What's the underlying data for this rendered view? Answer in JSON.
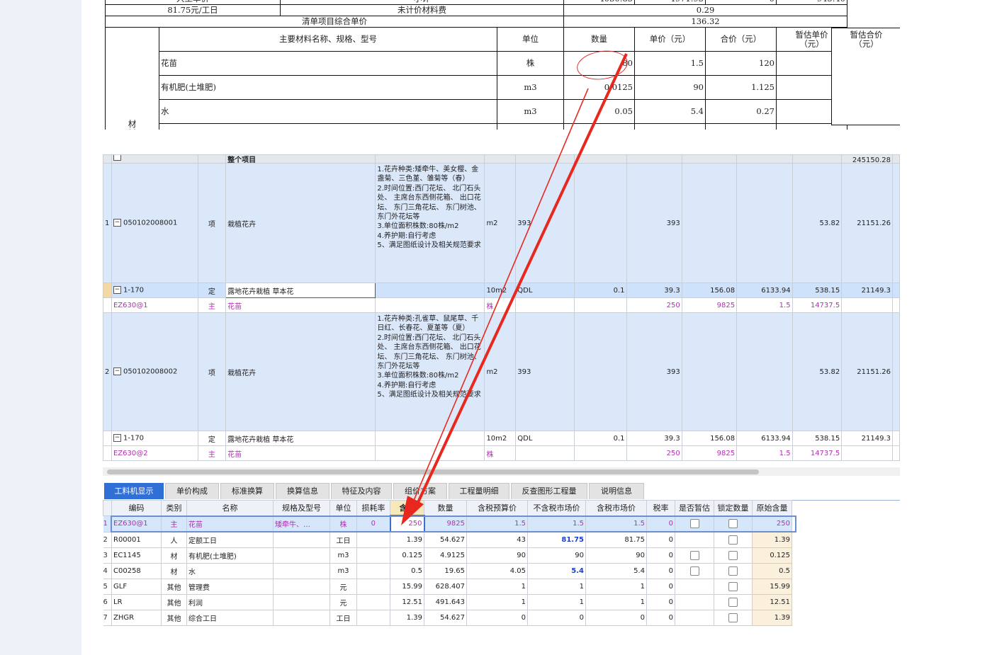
{
  "top_table": {
    "row_labor_price": "81.75元/工日",
    "row_unpriced_label": "未计价材料费",
    "row_unpriced_value": "0.29",
    "row_composite_label": "清单项目综合单价",
    "row_composite_value": "136.32",
    "header": {
      "name_spec": "主要材料名称、规格、型号",
      "unit": "单位",
      "qty": "数量",
      "unit_price": "单价（元）",
      "total_price": "合价（元）",
      "est_unit_price": "暂估单价（元）",
      "est_total_price": "暂估合价（元）"
    },
    "material_fee_label": "材料费",
    "rows": [
      {
        "name": "花苗",
        "unit": "株",
        "qty": "80",
        "price": "1.5",
        "total": "120"
      },
      {
        "name": "有机肥(土堆肥)",
        "unit": "m3",
        "qty": "0.0125",
        "price": "90",
        "total": "1.125"
      },
      {
        "name": "水",
        "unit": "m3",
        "qty": "0.05",
        "price": "5.4",
        "total": "0.27"
      }
    ]
  },
  "mid_grid": {
    "group_label": "整个项目",
    "group_total": "245150.28",
    "rows": [
      {
        "kind": "item",
        "no": "1",
        "code": "050102008001",
        "type": "项",
        "name": "栽植花卉",
        "desc": "1.花卉种类:矮牵牛、美女樱、金盏菊、三色堇、雏菊等（春）\n2.时间位置:西门花坛、 北门石头处、 主席台东西侧花箱、 出口花坛、 东门三角花坛、 东门树池、东门外花坛等\n3.单位面积株数:80株/m2\n4.养护期:自行考虑\n5、满足图纸设计及相关规范要求",
        "unit": "m2",
        "qty_expr": "393",
        "qty": "393",
        "c1": "",
        "c2": "",
        "c3": "",
        "unit_price": "53.82",
        "total": "21151.26"
      },
      {
        "kind": "quota",
        "code": "1-170",
        "type": "定",
        "name": "露地花卉栽植 草本花",
        "unit": "10m2",
        "qty_expr": "QDL",
        "content": "0.1",
        "qty": "39.3",
        "c1": "156.08",
        "c2": "6133.94",
        "unit_price": "538.15",
        "total": "21149.3"
      },
      {
        "kind": "mat",
        "code": "EZ630@1",
        "type": "主",
        "name": "花苗",
        "unit": "株",
        "content": "250",
        "qty": "9825",
        "c1": "1.5",
        "c2": "14737.5"
      },
      {
        "kind": "item",
        "no": "2",
        "code": "050102008002",
        "type": "项",
        "name": "栽植花卉",
        "desc": "1.花卉种类:孔雀草、鼠尾草、千日红、长春花、夏堇等（夏）\n2.时间位置:西门花坛、 北门石头处、 主席台东西侧花箱、 出口花坛、 东门三角花坛、 东门树池、东门外花坛等\n3.单位面积株数:80株/m2\n4.养护期:自行考虑\n5、满足图纸设计及相关规范要求",
        "unit": "m2",
        "qty_expr": "393",
        "qty": "393",
        "c1": "",
        "c2": "",
        "c3": "",
        "unit_price": "53.82",
        "total": "21151.26"
      },
      {
        "kind": "quota",
        "code": "1-170",
        "type": "定",
        "name": "露地花卉栽植 草本花",
        "unit": "10m2",
        "qty_expr": "QDL",
        "content": "0.1",
        "qty": "39.3",
        "c1": "156.08",
        "c2": "6133.94",
        "unit_price": "538.15",
        "total": "21149.3"
      },
      {
        "kind": "mat",
        "code": "EZ630@2",
        "type": "主",
        "name": "花苗",
        "unit": "株",
        "content": "250",
        "qty": "9825",
        "c1": "1.5",
        "c2": "14737.5"
      }
    ]
  },
  "tabs": [
    "工料机显示",
    "单价构成",
    "标准换算",
    "换算信息",
    "特征及内容",
    "组价方案",
    "工程量明细",
    "反查图形工程量",
    "说明信息"
  ],
  "detail": {
    "headers": [
      "编码",
      "类别",
      "名称",
      "规格及型号",
      "单位",
      "损耗率",
      "含量",
      "数量",
      "含税预算价",
      "不含税市场价",
      "含税市场价",
      "税率",
      "是否暂估",
      "锁定数量",
      "原始含量"
    ],
    "rows": [
      {
        "no": "1",
        "code": "EZ630@1",
        "cat": "主",
        "name": "花苗",
        "spec": "矮牵牛、…",
        "unit": "株",
        "loss": "0",
        "content": "250",
        "qty": "9825",
        "budget": "1.5",
        "market_ex": "1.5",
        "market_in": "1.5",
        "tax": "0",
        "est": true,
        "lock": true,
        "orig": "250"
      },
      {
        "no": "2",
        "code": "R00001",
        "cat": "人",
        "name": "定额工日",
        "spec": "",
        "unit": "工日",
        "loss": "",
        "content": "1.39",
        "qty": "54.627",
        "budget": "43",
        "market_ex": "81.75",
        "market_in": "81.75",
        "tax": "0",
        "est": false,
        "lock": true,
        "orig": "1.39"
      },
      {
        "no": "3",
        "code": "EC1145",
        "cat": "材",
        "name": "有机肥(土堆肥)",
        "spec": "",
        "unit": "m3",
        "loss": "",
        "content": "0.125",
        "qty": "4.9125",
        "budget": "90",
        "market_ex": "90",
        "market_in": "90",
        "tax": "0",
        "est": true,
        "lock": true,
        "orig": "0.125"
      },
      {
        "no": "4",
        "code": "C00258",
        "cat": "材",
        "name": "水",
        "spec": "",
        "unit": "m3",
        "loss": "",
        "content": "0.5",
        "qty": "19.65",
        "budget": "4.05",
        "market_ex": "5.4",
        "market_in": "5.4",
        "tax": "0",
        "est": true,
        "lock": true,
        "orig": "0.5"
      },
      {
        "no": "5",
        "code": "GLF",
        "cat": "其他",
        "name": "管理费",
        "spec": "",
        "unit": "元",
        "loss": "",
        "content": "15.99",
        "qty": "628.407",
        "budget": "1",
        "market_ex": "1",
        "market_in": "1",
        "tax": "0",
        "est": false,
        "lock": true,
        "orig": "15.99"
      },
      {
        "no": "6",
        "code": "LR",
        "cat": "其他",
        "name": "利润",
        "spec": "",
        "unit": "元",
        "loss": "",
        "content": "12.51",
        "qty": "491.643",
        "budget": "1",
        "market_ex": "1",
        "market_in": "1",
        "tax": "0",
        "est": false,
        "lock": true,
        "orig": "12.51"
      },
      {
        "no": "7",
        "code": "ZHGR",
        "cat": "其他",
        "name": "综合工日",
        "spec": "",
        "unit": "工日",
        "loss": "",
        "content": "1.39",
        "qty": "54.627",
        "budget": "0",
        "market_ex": "0",
        "market_in": "0",
        "tax": "0",
        "est": false,
        "lock": true,
        "orig": "1.39"
      }
    ]
  },
  "colors": {
    "accent": "#2f6fd6",
    "material_text": "#b030b0",
    "annotation": "#e8281e",
    "highlight_blue": "#1a3fd0"
  }
}
